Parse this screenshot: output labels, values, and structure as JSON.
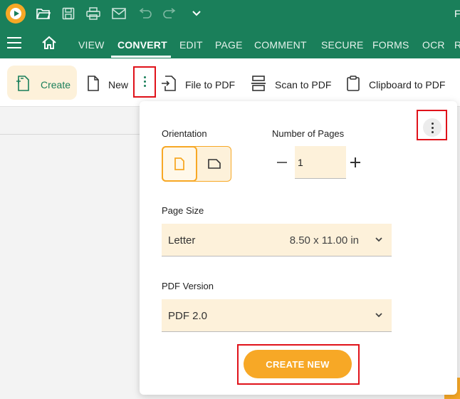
{
  "titlebar": {
    "title_fragment": "F",
    "icons": [
      "app-logo-icon",
      "open-folder-icon",
      "save-icon",
      "print-icon",
      "mail-icon",
      "undo-icon",
      "redo-icon",
      "chevron-down-icon"
    ]
  },
  "menu": {
    "tabs": [
      "VIEW",
      "CONVERT",
      "EDIT",
      "PAGE",
      "COMMENT",
      "SECURE",
      "FORMS",
      "OCR",
      "R"
    ],
    "active": "CONVERT"
  },
  "toolbar": {
    "create_label": "Create",
    "new_label": "New",
    "file_to_pdf_label": "File to PDF",
    "scan_to_pdf_label": "Scan to PDF",
    "clipboard_to_pdf_label": "Clipboard to PDF"
  },
  "panel": {
    "orientation_label": "Orientation",
    "pages_label": "Number of Pages",
    "pages_value": "1",
    "page_size_label": "Page Size",
    "page_size_value": "Letter",
    "page_size_dims": "8.50 x 11.00 in",
    "pdf_version_label": "PDF Version",
    "pdf_version_value": "PDF 2.0",
    "create_button": "CREATE NEW"
  },
  "colors": {
    "brand_green": "#1a7f5a",
    "accent_orange": "#f7a826",
    "highlight_red": "#e0121a"
  }
}
